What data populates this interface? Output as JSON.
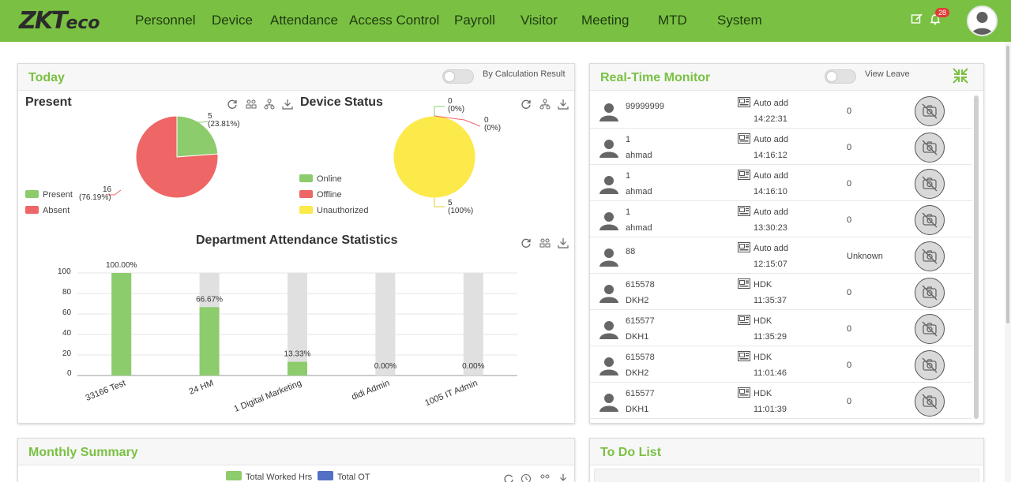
{
  "nav": {
    "logo_main": "ZKT",
    "logo_sub": "eco",
    "items": [
      "Personnel",
      "Device",
      "Attendance",
      "Access Control",
      "Payroll",
      "Visitor",
      "Meeting",
      "MTD",
      "System"
    ],
    "notification_count": "28"
  },
  "today": {
    "title": "Today",
    "toggle_label": "By Calculation Result",
    "present": {
      "title": "Present",
      "legend": [
        {
          "label": "Present",
          "color": "#8dcc6c"
        },
        {
          "label": "Absent",
          "color": "#ee6666"
        }
      ],
      "present_value": "5",
      "present_pct": "(23.81%)",
      "absent_value": "16",
      "absent_pct": "(76.19%)"
    },
    "device_status": {
      "title": "Device Status",
      "legend": [
        {
          "label": "Online",
          "color": "#8dcc6c"
        },
        {
          "label": "Offline",
          "color": "#ee6666"
        },
        {
          "label": "Unauthorized",
          "color": "#fce94a"
        }
      ],
      "online_value": "0",
      "online_pct": "(0%)",
      "offline_value": "0",
      "offline_pct": "(0%)",
      "unauth_value": "5",
      "unauth_pct": "(100%)"
    },
    "department": {
      "title": "Department Attendance Statistics",
      "y_ticks": [
        "100",
        "80",
        "60",
        "40",
        "20",
        "0"
      ]
    }
  },
  "chart_data": [
    {
      "type": "pie",
      "title": "Present",
      "categories": [
        "Present",
        "Absent"
      ],
      "values": [
        5,
        16
      ],
      "colors": [
        "#8dcc6c",
        "#ee6666"
      ]
    },
    {
      "type": "pie",
      "title": "Device Status",
      "categories": [
        "Online",
        "Offline",
        "Unauthorized"
      ],
      "values": [
        0,
        0,
        5
      ],
      "colors": [
        "#8dcc6c",
        "#ee6666",
        "#fce94a"
      ]
    },
    {
      "type": "bar",
      "title": "Department Attendance Statistics",
      "categories": [
        "33166 Test",
        "24 HM",
        "1 Digital Marketing",
        "didi Admin",
        "1005 IT Admin"
      ],
      "values": [
        100,
        66.67,
        13.33,
        0,
        0
      ],
      "data_labels": [
        "100.00%",
        "66.67%",
        "13.33%",
        "0.00%",
        "0.00%"
      ],
      "ylim": [
        0,
        100
      ],
      "grid": true,
      "bar_color": "#8dcc6c",
      "background_bar_color": "#e0e0e0"
    }
  ],
  "realtime": {
    "title": "Real-Time Monitor",
    "toggle_label": "View Leave",
    "rows": [
      {
        "id": "99999999",
        "name": "",
        "source": "Auto add",
        "time": "14:22:31",
        "status": "0"
      },
      {
        "id": "1",
        "name": "ahmad",
        "source": "Auto add",
        "time": "14:16:12",
        "status": "0"
      },
      {
        "id": "1",
        "name": "ahmad",
        "source": "Auto add",
        "time": "14:16:10",
        "status": "0"
      },
      {
        "id": "1",
        "name": "ahmad",
        "source": "Auto add",
        "time": "13:30:23",
        "status": "0"
      },
      {
        "id": "88",
        "name": "",
        "source": "Auto add",
        "time": "12:15:07",
        "status": "Unknown"
      },
      {
        "id": "615578",
        "name": "DKH2",
        "source": "HDK",
        "time": "11:35:37",
        "status": "0"
      },
      {
        "id": "615577",
        "name": "DKH1",
        "source": "HDK",
        "time": "11:35:29",
        "status": "0"
      },
      {
        "id": "615578",
        "name": "DKH2",
        "source": "HDK",
        "time": "11:01:46",
        "status": "0"
      },
      {
        "id": "615577",
        "name": "DKH1",
        "source": "HDK",
        "time": "11:01:39",
        "status": "0"
      }
    ]
  },
  "monthly": {
    "title": "Monthly Summary",
    "legend": [
      {
        "label": "Total Worked Hrs",
        "color": "#8dcc6c"
      },
      {
        "label": "Total OT",
        "color": "#5470c6"
      }
    ]
  },
  "todo": {
    "title": "To Do List"
  }
}
